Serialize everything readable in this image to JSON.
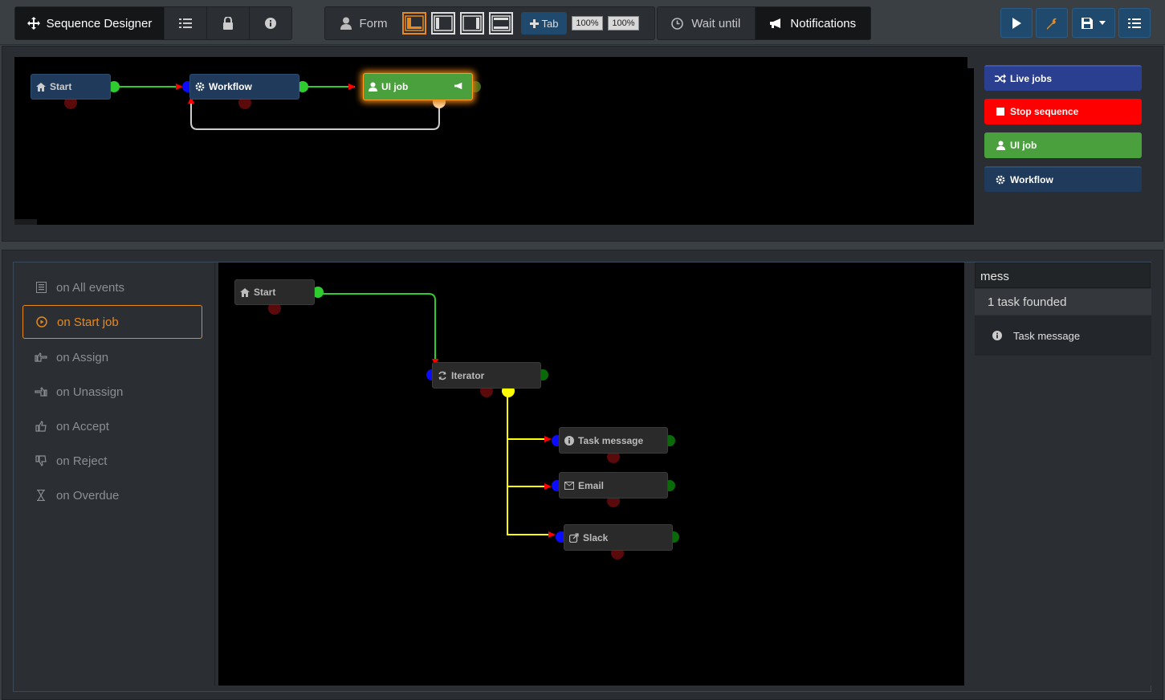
{
  "toolbar": {
    "title": "Sequence Designer",
    "form_label": "Form",
    "tab_label": "Tab",
    "zoom1": "100%",
    "zoom2": "100%",
    "wait_label": "Wait until",
    "notifications_label": "Notifications"
  },
  "upper_flow": {
    "start_label": "Start",
    "workflow_label": "Workflow",
    "uijob_label": "UI job"
  },
  "side_buttons": {
    "live_jobs": "Live jobs",
    "stop_sequence": "Stop sequence",
    "ui_job": "UI job",
    "workflow": "Workflow"
  },
  "events": [
    {
      "label": "on All events",
      "icon": "list-icon"
    },
    {
      "label": "on Start job",
      "icon": "play-circle-icon"
    },
    {
      "label": "on Assign",
      "icon": "hand-right-icon"
    },
    {
      "label": "on Unassign",
      "icon": "hand-left-icon"
    },
    {
      "label": "on Accept",
      "icon": "thumbs-up-icon"
    },
    {
      "label": "on Reject",
      "icon": "thumbs-down-icon"
    },
    {
      "label": "on Overdue",
      "icon": "hourglass-icon"
    }
  ],
  "lower_flow": {
    "start_label": "Start",
    "iterator_label": "Iterator",
    "task_message_label": "Task message",
    "email_label": "Email",
    "slack_label": "Slack"
  },
  "search": {
    "value": "mess",
    "result_count": "1 task founded",
    "result_item": "Task message"
  },
  "colors": {
    "accent_orange": "#e8891c",
    "node_blue": "#1f3a5a",
    "node_green": "#4aa03c",
    "stop_red": "#ff0000",
    "live_blue": "#2a3f8f"
  }
}
